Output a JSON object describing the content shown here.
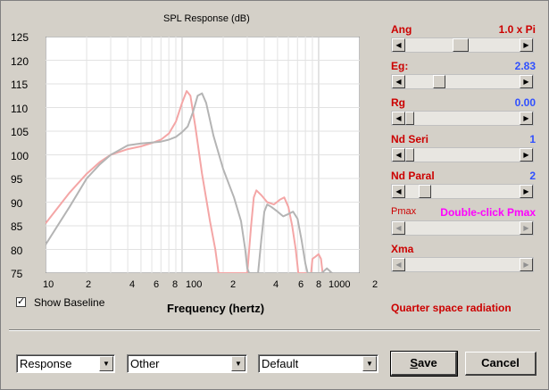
{
  "graph": {
    "title": "SPL Response (dB)",
    "x_label": "Frequency (hertz)",
    "baseline_label": "Show Baseline",
    "radiation_label": "Quarter space radiation"
  },
  "chart_data": {
    "type": "line",
    "title": "SPL Response (dB)",
    "xlabel": "Frequency (hertz)",
    "ylabel": "",
    "x_scale": "log",
    "xlim": [
      10,
      2000
    ],
    "ylim": [
      75,
      125
    ],
    "grid": true,
    "y_ticks": [
      75,
      80,
      85,
      90,
      95,
      100,
      105,
      110,
      115,
      120,
      125
    ],
    "x_tick_labels": [
      {
        "value": 10,
        "label": "10"
      },
      {
        "value": 20,
        "label": "2"
      },
      {
        "value": 40,
        "label": "4"
      },
      {
        "value": 60,
        "label": "6"
      },
      {
        "value": 80,
        "label": "8"
      },
      {
        "value": 100,
        "label": "100"
      },
      {
        "value": 200,
        "label": "2"
      },
      {
        "value": 400,
        "label": "4"
      },
      {
        "value": 600,
        "label": "6"
      },
      {
        "value": 800,
        "label": "8"
      },
      {
        "value": 1000,
        "label": "1000"
      },
      {
        "value": 2000,
        "label": "2"
      }
    ],
    "series": [
      {
        "color": "#f4a6a6",
        "points": [
          [
            10,
            85.5
          ],
          [
            15,
            92
          ],
          [
            20,
            96
          ],
          [
            25,
            98.5
          ],
          [
            30,
            100
          ],
          [
            40,
            101.2
          ],
          [
            50,
            101.8
          ],
          [
            60,
            102.5
          ],
          [
            70,
            103.2
          ],
          [
            80,
            104.5
          ],
          [
            90,
            107
          ],
          [
            100,
            111
          ],
          [
            108,
            113.5
          ],
          [
            115,
            112.5
          ],
          [
            125,
            106
          ],
          [
            140,
            96
          ],
          [
            160,
            86
          ],
          [
            175,
            80
          ],
          [
            185,
            75
          ],
          [
            300,
            75
          ],
          [
            320,
            85
          ],
          [
            335,
            91
          ],
          [
            350,
            92.5
          ],
          [
            380,
            91.5
          ],
          [
            420,
            90
          ],
          [
            470,
            89.5
          ],
          [
            520,
            90.5
          ],
          [
            560,
            91
          ],
          [
            600,
            89
          ],
          [
            640,
            85
          ],
          [
            680,
            80
          ],
          [
            710,
            75
          ],
          [
            880,
            75
          ],
          [
            900,
            78
          ],
          [
            950,
            78.5
          ],
          [
            1000,
            79
          ],
          [
            1040,
            78
          ],
          [
            1070,
            75
          ]
        ]
      },
      {
        "color": "#b4b4b4",
        "points": [
          [
            10,
            81
          ],
          [
            15,
            89
          ],
          [
            20,
            95
          ],
          [
            25,
            98
          ],
          [
            30,
            100
          ],
          [
            40,
            102
          ],
          [
            50,
            102.4
          ],
          [
            60,
            102.6
          ],
          [
            70,
            102.8
          ],
          [
            80,
            103.2
          ],
          [
            90,
            103.8
          ],
          [
            100,
            104.8
          ],
          [
            110,
            106
          ],
          [
            120,
            109
          ],
          [
            130,
            112.5
          ],
          [
            140,
            113
          ],
          [
            150,
            111
          ],
          [
            170,
            104
          ],
          [
            200,
            97
          ],
          [
            240,
            91
          ],
          [
            270,
            86
          ],
          [
            290,
            80
          ],
          [
            300,
            76
          ],
          [
            310,
            75
          ],
          [
            360,
            75
          ],
          [
            380,
            82
          ],
          [
            400,
            88
          ],
          [
            420,
            89.5
          ],
          [
            450,
            89
          ],
          [
            500,
            88
          ],
          [
            550,
            87
          ],
          [
            600,
            87.5
          ],
          [
            650,
            88
          ],
          [
            700,
            86.5
          ],
          [
            750,
            82
          ],
          [
            800,
            77
          ],
          [
            830,
            75
          ],
          [
            1050,
            75
          ],
          [
            1100,
            75.5
          ],
          [
            1150,
            76
          ],
          [
            1200,
            75.5
          ],
          [
            1250,
            75
          ]
        ]
      }
    ]
  },
  "params": [
    {
      "label": "Ang",
      "value": "1.0 x Pi",
      "value_color": "#cc0000",
      "position": 0.5
    },
    {
      "label": "Eg:",
      "value": "2.83",
      "value_color": "#3050ff",
      "position": 0.3
    },
    {
      "label": "Rg",
      "value": "0.00",
      "value_color": "#3050ff",
      "position": 0.0
    },
    {
      "label": "Nd  Seri",
      "value": "1",
      "value_color": "#3050ff",
      "position": 0.0
    },
    {
      "label": "Nd  Paral",
      "value": "2",
      "value_color": "#3050ff",
      "position": 0.1
    },
    {
      "label": "Pmax",
      "value": "Double-click Pmax",
      "value_color": "#ff00ff",
      "position": null
    },
    {
      "label": "Xma",
      "value": "",
      "value_color": "#cc0000",
      "position": null
    }
  ],
  "selects": [
    {
      "value": "Response"
    },
    {
      "value": "Other"
    },
    {
      "value": "Default"
    }
  ],
  "buttons": {
    "save": "Save",
    "cancel": "Cancel"
  }
}
